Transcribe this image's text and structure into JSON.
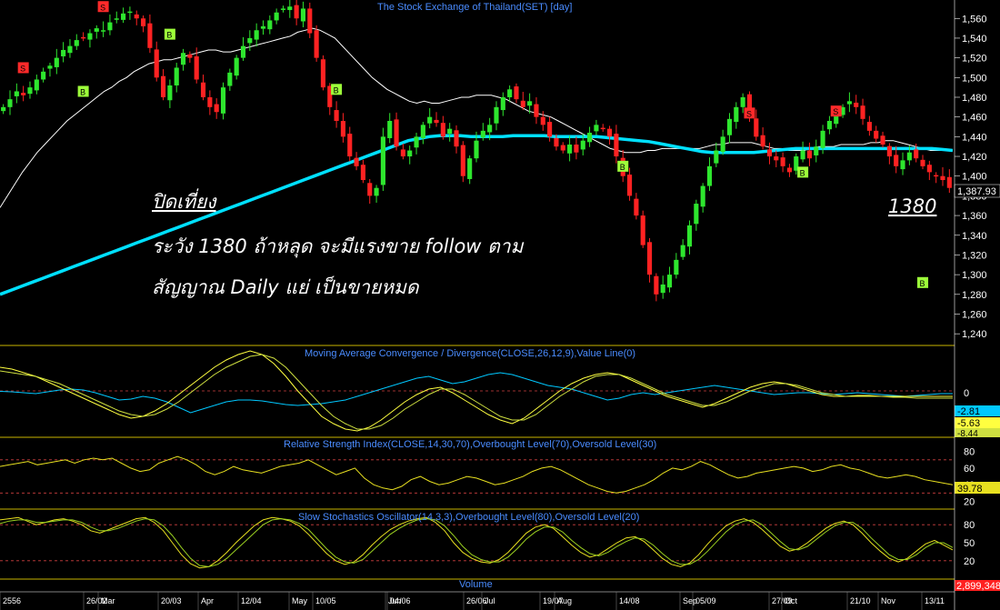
{
  "chart_data": [
    {
      "type": "candlestick",
      "title": "The Stock Exchange of Thailand(SET) [day]",
      "ylim": [
        1230,
        1575
      ],
      "yticks": [
        1240,
        1260,
        1280,
        1300,
        1320,
        1340,
        1360,
        1380,
        1400,
        1420,
        1440,
        1460,
        1480,
        1500,
        1520,
        1540,
        1560
      ],
      "last_value": "1,387.93",
      "closes": [
        1470,
        1478,
        1486,
        1482,
        1490,
        1498,
        1506,
        1512,
        1520,
        1528,
        1532,
        1538,
        1540,
        1545,
        1550,
        1548,
        1556,
        1560,
        1565,
        1567,
        1560,
        1552,
        1530,
        1500,
        1480,
        1492,
        1510,
        1525,
        1520,
        1498,
        1480,
        1470,
        1465,
        1490,
        1505,
        1520,
        1532,
        1540,
        1548,
        1552,
        1558,
        1566,
        1570,
        1572,
        1560,
        1570,
        1545,
        1520,
        1490,
        1470,
        1456,
        1440,
        1420,
        1410,
        1396,
        1380,
        1388,
        1440,
        1456,
        1430,
        1420,
        1426,
        1440,
        1452,
        1460,
        1454,
        1440,
        1448,
        1430,
        1400,
        1418,
        1436,
        1446,
        1452,
        1470,
        1480,
        1488,
        1478,
        1470,
        1476,
        1460,
        1452,
        1440,
        1430,
        1426,
        1432,
        1424,
        1436,
        1444,
        1452,
        1448,
        1440,
        1420,
        1400,
        1380,
        1360,
        1330,
        1300,
        1280,
        1290,
        1300,
        1315,
        1330,
        1350,
        1372,
        1390,
        1410,
        1426,
        1440,
        1458,
        1470,
        1480,
        1460,
        1440,
        1430,
        1420,
        1416,
        1410,
        1404,
        1420,
        1426,
        1418,
        1430,
        1446,
        1456,
        1462,
        1470,
        1476,
        1470,
        1458,
        1446,
        1438,
        1432,
        1420,
        1410,
        1416,
        1424,
        1418,
        1410,
        1404,
        1400,
        1396,
        1388
      ],
      "series": [
        {
          "name": "",
          "color": "#ffffff",
          "values": [
            1368,
            1380,
            1392,
            1404,
            1414,
            1424,
            1432,
            1440,
            1448,
            1456,
            1462,
            1468,
            1474,
            1480,
            1486,
            1490,
            1496,
            1500,
            1506,
            1510,
            1514,
            1516,
            1518,
            1518,
            1520,
            1522,
            1524,
            1526,
            1528,
            1528,
            1526,
            1526,
            1528,
            1530,
            1532,
            1534,
            1536,
            1538,
            1540,
            1542,
            1546,
            1548,
            1550,
            1548,
            1544,
            1540,
            1532,
            1524,
            1516,
            1508,
            1500,
            1494,
            1488,
            1484,
            1480,
            1476,
            1474,
            1476,
            1474,
            1474,
            1476,
            1478,
            1480,
            1480,
            1482,
            1482,
            1482,
            1480,
            1478,
            1474,
            1470,
            1466,
            1464,
            1462,
            1460,
            1456,
            1452,
            1448,
            1444,
            1440,
            1436,
            1432,
            1428,
            1426,
            1424,
            1424,
            1424,
            1426,
            1426,
            1428,
            1428,
            1428,
            1428,
            1428,
            1428,
            1430,
            1432,
            1432,
            1434,
            1434,
            1434,
            1434,
            1432,
            1430,
            1428,
            1428,
            1426,
            1426,
            1426,
            1428,
            1430,
            1430,
            1430,
            1432,
            1432,
            1432,
            1432,
            1434,
            1434,
            1436,
            1436,
            1434,
            1432,
            1430,
            1428,
            1426,
            1426,
            1426,
            1426
          ]
        },
        {
          "name": "",
          "color": "#00e0ff",
          "values": [
            1280,
            1284,
            1288,
            1292,
            1296,
            1300,
            1304,
            1308,
            1312,
            1316,
            1320,
            1324,
            1328,
            1332,
            1336,
            1340,
            1344,
            1348,
            1352,
            1356,
            1360,
            1364,
            1368,
            1372,
            1376,
            1380,
            1384,
            1388,
            1392,
            1396,
            1400,
            1404,
            1408,
            1412,
            1416,
            1420,
            1424,
            1428,
            1432,
            1436,
            1438,
            1440,
            1441,
            1441,
            1441,
            1440,
            1440,
            1440,
            1440,
            1441,
            1441,
            1441,
            1441,
            1440,
            1440,
            1440,
            1440,
            1440,
            1439,
            1438,
            1437,
            1436,
            1435,
            1433,
            1431,
            1429,
            1427,
            1425,
            1424,
            1424,
            1424,
            1424,
            1424,
            1425,
            1426,
            1427,
            1428,
            1428,
            1428,
            1428,
            1428,
            1428,
            1428,
            1428,
            1428,
            1428,
            1428,
            1428,
            1428,
            1428,
            1427,
            1426
          ]
        }
      ],
      "signals": [
        {
          "label": "S",
          "color": "#ff2a2a",
          "i": 3,
          "v": 1510
        },
        {
          "label": "S",
          "color": "#ff2a2a",
          "i": 15,
          "v": 1572
        },
        {
          "label": "B",
          "color": "#9dff3a",
          "i": 12,
          "v": 1486
        },
        {
          "label": "B",
          "color": "#9dff3a",
          "i": 25,
          "v": 1544
        },
        {
          "label": "B",
          "color": "#9dff3a",
          "i": 50,
          "v": 1488
        },
        {
          "label": "B",
          "color": "#9dff3a",
          "i": 93,
          "v": 1410
        },
        {
          "label": "S",
          "color": "#ff2a2a",
          "i": 112,
          "v": 1464
        },
        {
          "label": "B",
          "color": "#9dff3a",
          "i": 120,
          "v": 1404
        },
        {
          "label": "S",
          "color": "#ff2a2a",
          "i": 125,
          "v": 1466
        },
        {
          "label": "B",
          "color": "#9dff3a",
          "i": 138,
          "v": 1292
        },
        {
          "label": "B",
          "color": "#9dff3a",
          "i": 161,
          "v": 1400
        },
        {
          "label": "S",
          "color": "#ff2a2a",
          "i": 171,
          "v": 1490
        }
      ]
    },
    {
      "type": "line",
      "title": "Moving Average Convergence / Divergence(CLOSE,26,12,9),Value Line(0)",
      "yticks": [
        0
      ],
      "last_values": [
        "-2.81",
        "-5.63",
        "-8.44"
      ],
      "series": [
        {
          "name": "",
          "color": "#00c8ff",
          "values": [
            -0.5,
            -1,
            -2,
            -3,
            -1,
            1,
            2,
            1,
            -2,
            -6,
            -10,
            -9,
            -6,
            -8,
            -12,
            -18,
            -24,
            -20,
            -16,
            -12,
            -10,
            -10,
            -11,
            -13,
            -15,
            -16,
            -15,
            -14,
            -12,
            -10,
            -6,
            -2,
            2,
            6,
            10,
            14,
            16,
            12,
            8,
            10,
            14,
            18,
            20,
            18,
            14,
            10,
            6,
            4,
            2,
            -2,
            -6,
            -10,
            -8,
            -4,
            -2,
            -4,
            -2,
            0,
            2,
            4,
            6,
            4,
            2,
            0,
            -2,
            -4,
            -3,
            -2,
            -2,
            -3,
            -4,
            -3,
            -2,
            -3,
            -4,
            -5,
            -6,
            -5,
            -4,
            -3,
            -3
          ]
        },
        {
          "name": "",
          "color": "#ffff40",
          "values": [
            26,
            24,
            20,
            16,
            10,
            4,
            -2,
            -8,
            -14,
            -20,
            -26,
            -30,
            -28,
            -22,
            -14,
            -4,
            6,
            16,
            26,
            34,
            40,
            44,
            40,
            30,
            16,
            0,
            -14,
            -28,
            -36,
            -42,
            -44,
            -40,
            -32,
            -22,
            -12,
            -4,
            2,
            4,
            -2,
            -10,
            -18,
            -26,
            -32,
            -36,
            -30,
            -20,
            -10,
            0,
            8,
            14,
            18,
            20,
            18,
            12,
            6,
            0,
            -6,
            -10,
            -14,
            -18,
            -14,
            -8,
            -2,
            4,
            8,
            10,
            8,
            4,
            0,
            -4,
            -6,
            -6,
            -5,
            -5,
            -6,
            -6,
            -6,
            -6,
            -6,
            -6,
            -6
          ]
        },
        {
          "name": "",
          "color": "#cfe040",
          "values": [
            22,
            20,
            18,
            16,
            12,
            8,
            2,
            -4,
            -10,
            -16,
            -22,
            -26,
            -28,
            -26,
            -20,
            -12,
            -2,
            8,
            18,
            26,
            32,
            38,
            40,
            36,
            26,
            12,
            -2,
            -16,
            -28,
            -36,
            -42,
            -42,
            -38,
            -30,
            -20,
            -12,
            -4,
            2,
            2,
            -4,
            -12,
            -20,
            -28,
            -32,
            -32,
            -26,
            -16,
            -6,
            2,
            10,
            16,
            18,
            18,
            14,
            8,
            2,
            -4,
            -8,
            -12,
            -16,
            -16,
            -12,
            -6,
            0,
            4,
            8,
            8,
            6,
            2,
            -2,
            -4,
            -6,
            -6,
            -6,
            -6,
            -7,
            -7,
            -8,
            -8,
            -8,
            -8
          ]
        }
      ]
    },
    {
      "type": "line",
      "title": "Relative Strength Index(CLOSE,14,30,70),Overbought Level(70),Oversold Level(30)",
      "ylim": [
        15,
        95
      ],
      "yticks": [
        20,
        40,
        60,
        80
      ],
      "levels": [
        70,
        30
      ],
      "last_value": "39.78",
      "series": [
        {
          "name": "",
          "color": "#e8e020",
          "values": [
            62,
            64,
            66,
            68,
            64,
            66,
            68,
            70,
            66,
            70,
            72,
            70,
            72,
            66,
            60,
            56,
            58,
            66,
            70,
            74,
            70,
            64,
            56,
            52,
            56,
            62,
            58,
            56,
            54,
            58,
            62,
            64,
            66,
            70,
            64,
            58,
            52,
            56,
            60,
            48,
            40,
            36,
            34,
            38,
            46,
            50,
            44,
            40,
            42,
            46,
            50,
            48,
            44,
            40,
            42,
            46,
            50,
            56,
            60,
            62,
            58,
            52,
            46,
            40,
            36,
            32,
            30,
            32,
            36,
            40,
            46,
            54,
            60,
            58,
            62,
            68,
            64,
            58,
            52,
            48,
            50,
            54,
            56,
            58,
            60,
            62,
            60,
            56,
            58,
            62,
            64,
            60,
            58,
            54,
            50,
            48,
            50,
            52,
            50,
            46,
            44,
            42,
            40
          ]
        }
      ]
    },
    {
      "type": "line",
      "title": "Slow Stochastics Oscillator(14,3,3),Overbought Level(80),Oversold Level(20)",
      "ylim": [
        0,
        100
      ],
      "yticks": [
        20,
        50,
        80
      ],
      "levels": [
        80,
        20
      ],
      "series": [
        {
          "name": "",
          "color": "#e8e020",
          "values": [
            88,
            90,
            92,
            86,
            80,
            84,
            88,
            90,
            86,
            80,
            70,
            66,
            72,
            78,
            84,
            90,
            92,
            84,
            70,
            50,
            30,
            15,
            8,
            10,
            20,
            34,
            50,
            64,
            78,
            88,
            92,
            90,
            86,
            78,
            64,
            48,
            32,
            20,
            14,
            18,
            30,
            46,
            60,
            72,
            80,
            86,
            90,
            92,
            84,
            70,
            50,
            34,
            24,
            18,
            16,
            22,
            34,
            50,
            66,
            76,
            80,
            74,
            60,
            46,
            34,
            26,
            30,
            40,
            50,
            58,
            60,
            52,
            38,
            24,
            14,
            10,
            16,
            30,
            48,
            64,
            78,
            86,
            90,
            84,
            72,
            58,
            44,
            36,
            40,
            50,
            62,
            74,
            82,
            86,
            80,
            66,
            50,
            36,
            24,
            18,
            24,
            36,
            48,
            54,
            46,
            38
          ]
        },
        {
          "name": "",
          "color": "#9ad020",
          "values": [
            82,
            86,
            88,
            88,
            84,
            84,
            86,
            88,
            88,
            84,
            76,
            70,
            70,
            74,
            80,
            86,
            90,
            88,
            78,
            62,
            42,
            24,
            12,
            10,
            14,
            24,
            38,
            52,
            66,
            80,
            88,
            90,
            88,
            82,
            72,
            56,
            40,
            26,
            18,
            16,
            22,
            36,
            50,
            64,
            74,
            82,
            88,
            90,
            88,
            78,
            62,
            44,
            30,
            22,
            18,
            18,
            26,
            40,
            56,
            68,
            76,
            76,
            68,
            54,
            42,
            32,
            28,
            34,
            44,
            52,
            58,
            56,
            46,
            32,
            20,
            14,
            14,
            22,
            36,
            52,
            68,
            80,
            86,
            88,
            80,
            66,
            52,
            40,
            38,
            44,
            56,
            68,
            78,
            84,
            84,
            74,
            58,
            44,
            30,
            22,
            22,
            30,
            42,
            50,
            50,
            42
          ]
        }
      ]
    },
    {
      "type": "bar",
      "title": "Volume",
      "last_value": "2,899,348"
    }
  ],
  "x_axis": {
    "labels": [
      "2556",
      "26/02",
      "Mar",
      "20/03",
      "Apr",
      "12/04",
      "May",
      "10/05",
      "Jun",
      "04/06",
      "26/06",
      "Jul",
      "19/07",
      "Aug",
      "14/08",
      "Sep",
      "05/09",
      "27/09",
      "Oct",
      "21/10",
      "Nov",
      "13/11"
    ]
  },
  "annotations": {
    "heading": "ปิดเที่ยง",
    "line1": "ระวัง 1380 ถ้าหลุด จะมีแรงขาย follow ตาม",
    "line2": "สัญญาณ Daily แย่ เป็นขายหมด",
    "level_label": "1380"
  }
}
